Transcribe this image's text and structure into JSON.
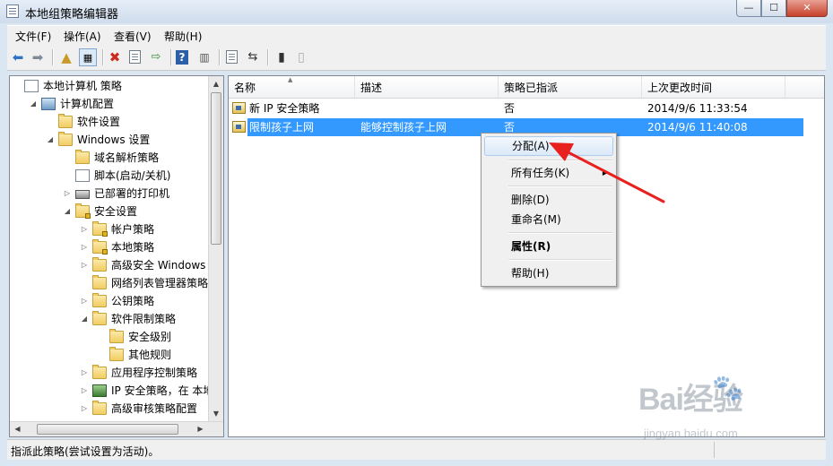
{
  "window": {
    "title": "本地组策略编辑器",
    "controls": {
      "minimize": "—",
      "maximize": "☐",
      "close": "✕"
    }
  },
  "menubar": {
    "items": [
      "文件(F)",
      "操作(A)",
      "查看(V)",
      "帮助(H)"
    ]
  },
  "toolbar": {
    "icons": [
      "back-icon",
      "forward-icon",
      "up-folder-icon",
      "show-hide-tree-icon",
      "delete-icon",
      "properties-icon",
      "export-icon",
      "help-icon",
      "show-action-pane-icon",
      "new-policy-icon",
      "manage-filters-icon",
      "assign-icon",
      "unassign-icon"
    ]
  },
  "tree": {
    "items": [
      {
        "label": "本地计算机 策略",
        "level": 0,
        "toggle": "",
        "icon": "document"
      },
      {
        "label": "计算机配置",
        "level": 1,
        "toggle": "◢",
        "icon": "computer"
      },
      {
        "label": "软件设置",
        "level": 2,
        "toggle": "",
        "icon": "folder"
      },
      {
        "label": "Windows 设置",
        "level": 2,
        "toggle": "◢",
        "icon": "folder"
      },
      {
        "label": "域名解析策略",
        "level": 3,
        "toggle": "",
        "icon": "folder"
      },
      {
        "label": "脚本(启动/关机)",
        "level": 3,
        "toggle": "",
        "icon": "document"
      },
      {
        "label": "已部署的打印机",
        "level": 3,
        "toggle": "▷",
        "icon": "printer"
      },
      {
        "label": "安全设置",
        "level": 3,
        "toggle": "◢",
        "icon": "lockfolder"
      },
      {
        "label": "帐户策略",
        "level": 4,
        "toggle": "▷",
        "icon": "lockfolder"
      },
      {
        "label": "本地策略",
        "level": 4,
        "toggle": "▷",
        "icon": "lockfolder"
      },
      {
        "label": "高级安全 Windows 防",
        "level": 4,
        "toggle": "▷",
        "icon": "folder"
      },
      {
        "label": "网络列表管理器策略",
        "level": 4,
        "toggle": "",
        "icon": "folder"
      },
      {
        "label": "公钥策略",
        "level": 4,
        "toggle": "▷",
        "icon": "folder"
      },
      {
        "label": "软件限制策略",
        "level": 4,
        "toggle": "◢",
        "icon": "folder"
      },
      {
        "label": "安全级别",
        "level": 5,
        "toggle": "",
        "icon": "folder"
      },
      {
        "label": "其他规则",
        "level": 5,
        "toggle": "",
        "icon": "folder"
      },
      {
        "label": "应用程序控制策略",
        "level": 4,
        "toggle": "▷",
        "icon": "folder"
      },
      {
        "label": "IP 安全策略，在 本地计",
        "level": 4,
        "toggle": "▷",
        "icon": "ip"
      },
      {
        "label": "高级审核策略配置",
        "level": 4,
        "toggle": "▷",
        "icon": "folder"
      }
    ]
  },
  "list": {
    "columns": [
      "名称",
      "描述",
      "策略已指派",
      "上次更改时间"
    ],
    "rows": [
      {
        "name": "新 IP 安全策略",
        "description": "",
        "assigned": "否",
        "modified": "2014/9/6 11:33:54",
        "selected": false
      },
      {
        "name": "限制孩子上网",
        "description": "能够控制孩子上网",
        "assigned": "否",
        "modified": "2014/9/6 11:40:08",
        "selected": true
      }
    ]
  },
  "context_menu": {
    "assign": "分配(A)",
    "all_tasks": "所有任务(K)",
    "delete": "删除(D)",
    "rename": "重命名(M)",
    "properties": "属性(R)",
    "help": "帮助(H)"
  },
  "status": {
    "text": "指派此策略(尝试设置为活动)。"
  },
  "watermark": {
    "logo": "Bai经验",
    "url": "jingyan.baidu.com"
  },
  "colors": {
    "selection": "#3399ff",
    "annotation_arrow": "#e8201e"
  }
}
